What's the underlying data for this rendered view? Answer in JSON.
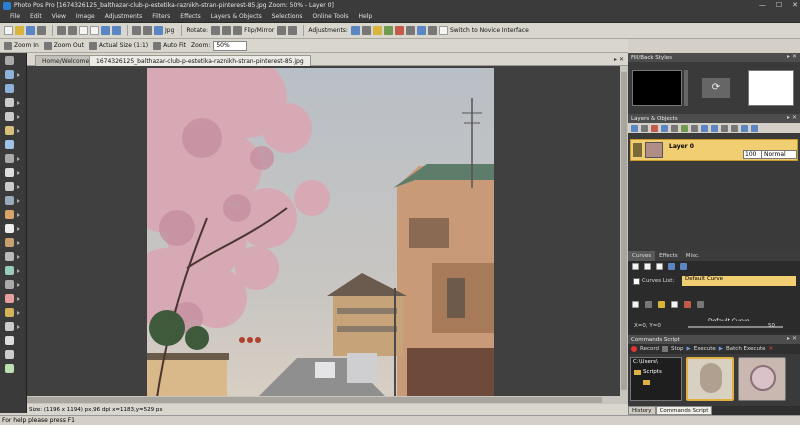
{
  "window": {
    "title": "Photo Pos Pro [1674326125_balthazar-club-p-estetika-raznikh-stran-pinterest-85.jpg Zoom: 50% - Layer 0]",
    "controls": [
      "—",
      "☐",
      "✕"
    ]
  },
  "menu": [
    "File",
    "Edit",
    "View",
    "Image",
    "Adjustments",
    "Filters",
    "Effects",
    "Layers & Objects",
    "Selections",
    "Online Tools",
    "Help"
  ],
  "toolbar1": {
    "format": "Jpg",
    "rotate": "Rotate:",
    "flip": "Flip/Mirror",
    "adjustments": "Adjustments:",
    "novice": "Switch to Novice Interface"
  },
  "toolbar2": {
    "zoom_in": "Zoom In",
    "zoom_out": "Zoom Out",
    "actual": "Actual Size (1:1)",
    "autofit": "Auto Fit",
    "zoom_label": "Zoom:",
    "zoom_value": "50%"
  },
  "tabs": {
    "welcome": "Home/Welcome",
    "file": "1674326125_balthazar-club-p-estetika-raznikh-stran-pinterest-85.jpg",
    "controls": "▸ ✕"
  },
  "doc_status": "Size: (1196 x 1194) px,96 dpi   x=1183,y=529 px",
  "status_bar": "For help please press F1",
  "panels": {
    "fill": "Fill/Back Styles",
    "layers": "Layers & Objects",
    "layer_name": "Layer 0",
    "opacity": "100",
    "blend": "Normal",
    "curves_tab": "Curves",
    "effects_tab": "Effects",
    "misc_tab": "Misc.",
    "curves_list_label": "Curves List:",
    "curves_value": "Default Curve",
    "curves_link": "Default Curve",
    "coords": "X=0, Y=0",
    "slider_value": "50",
    "commands": "Commands Script",
    "record": "Record",
    "stop": "Stop",
    "execute": "Execute",
    "batch": "Batch Execute",
    "path": "C:\\Users\\",
    "folder": "Scripts",
    "history_tab": "History",
    "commands_tab": "Commands Script"
  }
}
